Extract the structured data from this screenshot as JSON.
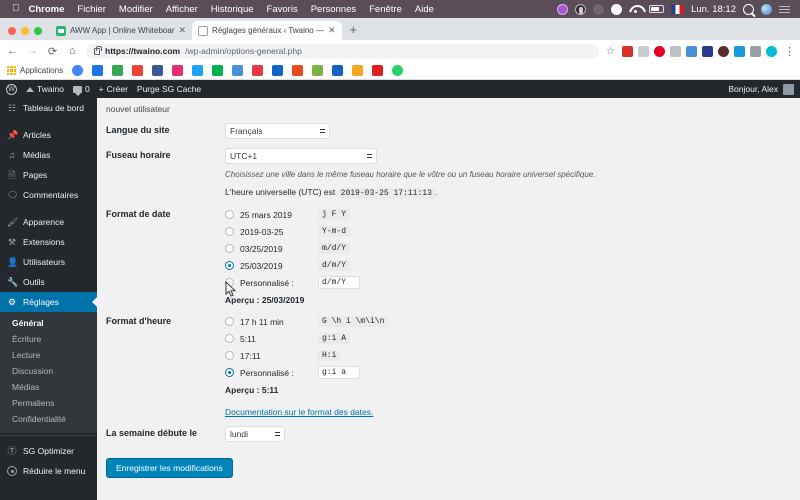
{
  "os_menubar": {
    "apple_icon": "apple-icon",
    "items": [
      "Chrome",
      "Fichier",
      "Modifier",
      "Afficher",
      "Historique",
      "Favoris",
      "Personnes",
      "Fenêtre",
      "Aide"
    ],
    "status_icons": [
      "siri-purple-icon",
      "record-icon",
      "dropbox-icon",
      "cloud-icon",
      "wifi-icon",
      "battery-icon",
      "french-flag-icon",
      "spotlight-search-icon",
      "siri-icon",
      "control-center-icon"
    ],
    "clock": "Lun. 18:12"
  },
  "browser": {
    "tabs": [
      {
        "favicon": "aww-app-favicon",
        "title": "AWW App | Online Whiteboar",
        "close": "✕",
        "active": false
      },
      {
        "favicon": "document-favicon",
        "title": "Réglages généraux ‹ Twaino —",
        "close": "✕",
        "active": true
      }
    ],
    "new_tab_label": "+",
    "nav": {
      "back": "←",
      "forward": "→",
      "reload": "⟳",
      "home": "⌂"
    },
    "url": {
      "lock": "lock-icon",
      "host": "https://twaino.com",
      "path": "/wp-admin/options-general.php"
    },
    "star_icon": "bookmark-star-icon",
    "menu_icon": "kebab-menu-icon",
    "extension_colors": [
      "#d93025",
      "#c8cdd1",
      "#e60023",
      "#bdc1c6",
      "#4a90d9",
      "#2b3a8f",
      "#5b2c2c",
      "#1a9bd7",
      "#9aa0a6",
      "#00bcd4"
    ],
    "bookmarks_label": "Applications",
    "bookmark_colors": [
      "#4285f4",
      "#1a73e8",
      "#34a853",
      "#ea4335",
      "#3b5998",
      "#e1306c",
      "#1da1f2",
      "#00b14f",
      "#4a90d9",
      "#e63946",
      "#0a66c2",
      "#e8491d",
      "#7cb342",
      "#1565c0",
      "#f5a623",
      "#e02020",
      "#25d366"
    ]
  },
  "wp_adminbar": {
    "logo": "wordpress-logo-icon",
    "site_name": "Twaino",
    "comment_count": "0",
    "new_label": "Créer",
    "purge_label": "Purge SG Cache",
    "greeting": "Bonjour, Alex"
  },
  "sidebar": {
    "items": [
      {
        "label": "Tableau de bord",
        "icon": "dashboard-icon"
      },
      {
        "label": "Articles",
        "icon": "pin-icon"
      },
      {
        "label": "Médias",
        "icon": "media-icon"
      },
      {
        "label": "Pages",
        "icon": "page-icon"
      },
      {
        "label": "Commentaires",
        "icon": "comment-icon"
      },
      {
        "label": "Apparence",
        "icon": "brush-icon"
      },
      {
        "label": "Extensions",
        "icon": "plugin-icon"
      },
      {
        "label": "Utilisateurs",
        "icon": "users-icon"
      },
      {
        "label": "Outils",
        "icon": "tools-icon"
      },
      {
        "label": "Réglages",
        "icon": "settings-icon"
      }
    ],
    "current_index": 9,
    "submenu": [
      {
        "label": "Général",
        "active": true
      },
      {
        "label": "Écriture",
        "active": false
      },
      {
        "label": "Lecture",
        "active": false
      },
      {
        "label": "Discussion",
        "active": false
      },
      {
        "label": "Médias",
        "active": false
      },
      {
        "label": "Permaliens",
        "active": false
      },
      {
        "label": "Confidentialité",
        "active": false
      }
    ],
    "footer": [
      {
        "label": "SG Optimizer",
        "icon": "siteground-icon"
      },
      {
        "label": "Réduire le menu",
        "icon": "collapse-icon"
      }
    ],
    "accent_color": "#0073aa",
    "background_color": "#23282d"
  },
  "main": {
    "clipped_text": "nouvel utilisateur",
    "language": {
      "label": "Langue du site",
      "value": "Français"
    },
    "timezone": {
      "label": "Fuseau horaire",
      "value": "UTC+1",
      "hint": "Choisissez une ville dans le même fuseau horaire que le vôtre ou un fuseau horaire universel spécifique.",
      "utc_prefix": "L'heure universelle (UTC) est",
      "utc_value": "2019-03-25 17:11:13",
      "utc_suffix": "."
    },
    "date_format": {
      "label": "Format de date",
      "options": [
        {
          "example": "25 mars 2019",
          "code": "j F Y",
          "checked": false
        },
        {
          "example": "2019-03-25",
          "code": "Y-m-d",
          "checked": false
        },
        {
          "example": "03/25/2019",
          "code": "m/d/Y",
          "checked": false
        },
        {
          "example": "25/03/2019",
          "code": "d/m/Y",
          "checked": true
        },
        {
          "example": "Personnalisé :",
          "code": "d/m/Y",
          "checked": false,
          "custom": true
        }
      ],
      "preview": "Aperçu : 25/03/2019"
    },
    "time_format": {
      "label": "Format d'heure",
      "options": [
        {
          "example": "17 h 11 min",
          "code": "G \\h i \\m\\i\\n",
          "checked": false
        },
        {
          "example": "5:11",
          "code": "g:i A",
          "checked": false
        },
        {
          "example": "17:11",
          "code": "H:i",
          "checked": false
        },
        {
          "example": "Personnalisé :",
          "code": "g:i a",
          "checked": true,
          "custom": true
        }
      ],
      "preview": "Aperçu : 5:11"
    },
    "doc_link": "Documentation sur le format des dates.",
    "week_start": {
      "label": "La semaine débute le",
      "value": "lundi"
    },
    "submit_label": "Enregistrer les modifications"
  }
}
